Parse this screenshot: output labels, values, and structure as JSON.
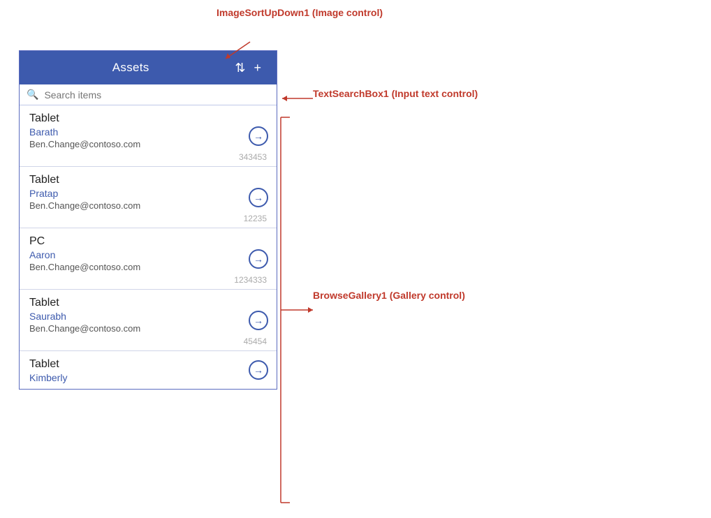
{
  "header": {
    "title": "Assets",
    "sort_icon": "↕",
    "add_icon": "+"
  },
  "search": {
    "placeholder": "Search items"
  },
  "items": [
    {
      "type": "Tablet",
      "name": "Barath",
      "email": "Ben.Change@contoso.com",
      "id": "343453"
    },
    {
      "type": "Tablet",
      "name": "Pratap",
      "email": "Ben.Change@contoso.com",
      "id": "12235"
    },
    {
      "type": "PC",
      "name": "Aaron",
      "email": "Ben.Change@contoso.com",
      "id": "1234333"
    },
    {
      "type": "Tablet",
      "name": "Saurabh",
      "email": "Ben.Change@contoso.com",
      "id": "45454"
    },
    {
      "type": "Tablet",
      "name": "Kimberly",
      "email": "",
      "id": ""
    }
  ],
  "annotations": {
    "sort_label": "ImageSortUpDown1 (Image control)",
    "search_label": "TextSearchBox1 (Input text control)",
    "gallery_label": "BrowseGallery1 (Gallery control)"
  }
}
